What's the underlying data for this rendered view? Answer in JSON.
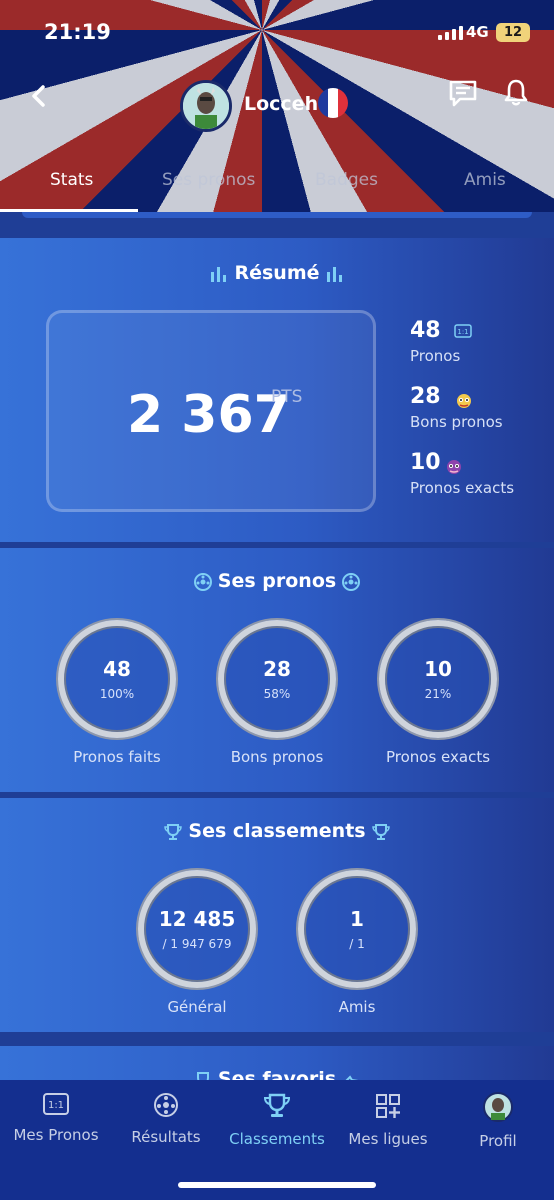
{
  "status": {
    "time": "21:19",
    "network": "4G",
    "battery": "12"
  },
  "header": {
    "username": "Locceh"
  },
  "tabs": [
    {
      "label": "Stats"
    },
    {
      "label": "Ses pronos"
    },
    {
      "label": "Badges"
    },
    {
      "label": "Amis"
    }
  ],
  "resume": {
    "title": "Résumé",
    "points": "2 367",
    "points_unit": "PTS",
    "stats": [
      {
        "value": "48",
        "label": "Pronos",
        "icon": "one-one-icon"
      },
      {
        "value": "28",
        "label": "Bons pronos",
        "icon": "monster-yellow-icon"
      },
      {
        "value": "10",
        "label": "Pronos exacts",
        "icon": "monster-purple-icon"
      }
    ]
  },
  "pronos": {
    "title": "Ses pronos",
    "rings": [
      {
        "value": "48",
        "sub": "100%",
        "label": "Pronos faits"
      },
      {
        "value": "28",
        "sub": "58%",
        "label": "Bons pronos"
      },
      {
        "value": "10",
        "sub": "21%",
        "label": "Pronos exacts"
      }
    ]
  },
  "classements": {
    "title": "Ses classements",
    "rings": [
      {
        "value": "12 485",
        "sub": "/ 1 947 679",
        "label": "Général"
      },
      {
        "value": "1",
        "sub": "/ 1",
        "label": "Amis"
      }
    ]
  },
  "favoris": {
    "title": "Ses favoris"
  },
  "nav": [
    {
      "label": "Mes Pronos",
      "icon": "one-one-icon"
    },
    {
      "label": "Résultats",
      "icon": "ball-icon"
    },
    {
      "label": "Classements",
      "icon": "trophy-icon"
    },
    {
      "label": "Mes ligues",
      "icon": "add-grid-icon"
    },
    {
      "label": "Profil",
      "icon": "avatar-icon"
    }
  ],
  "colors": {
    "accent": "#7fd0f5",
    "nav_bg": "#142f8f"
  }
}
